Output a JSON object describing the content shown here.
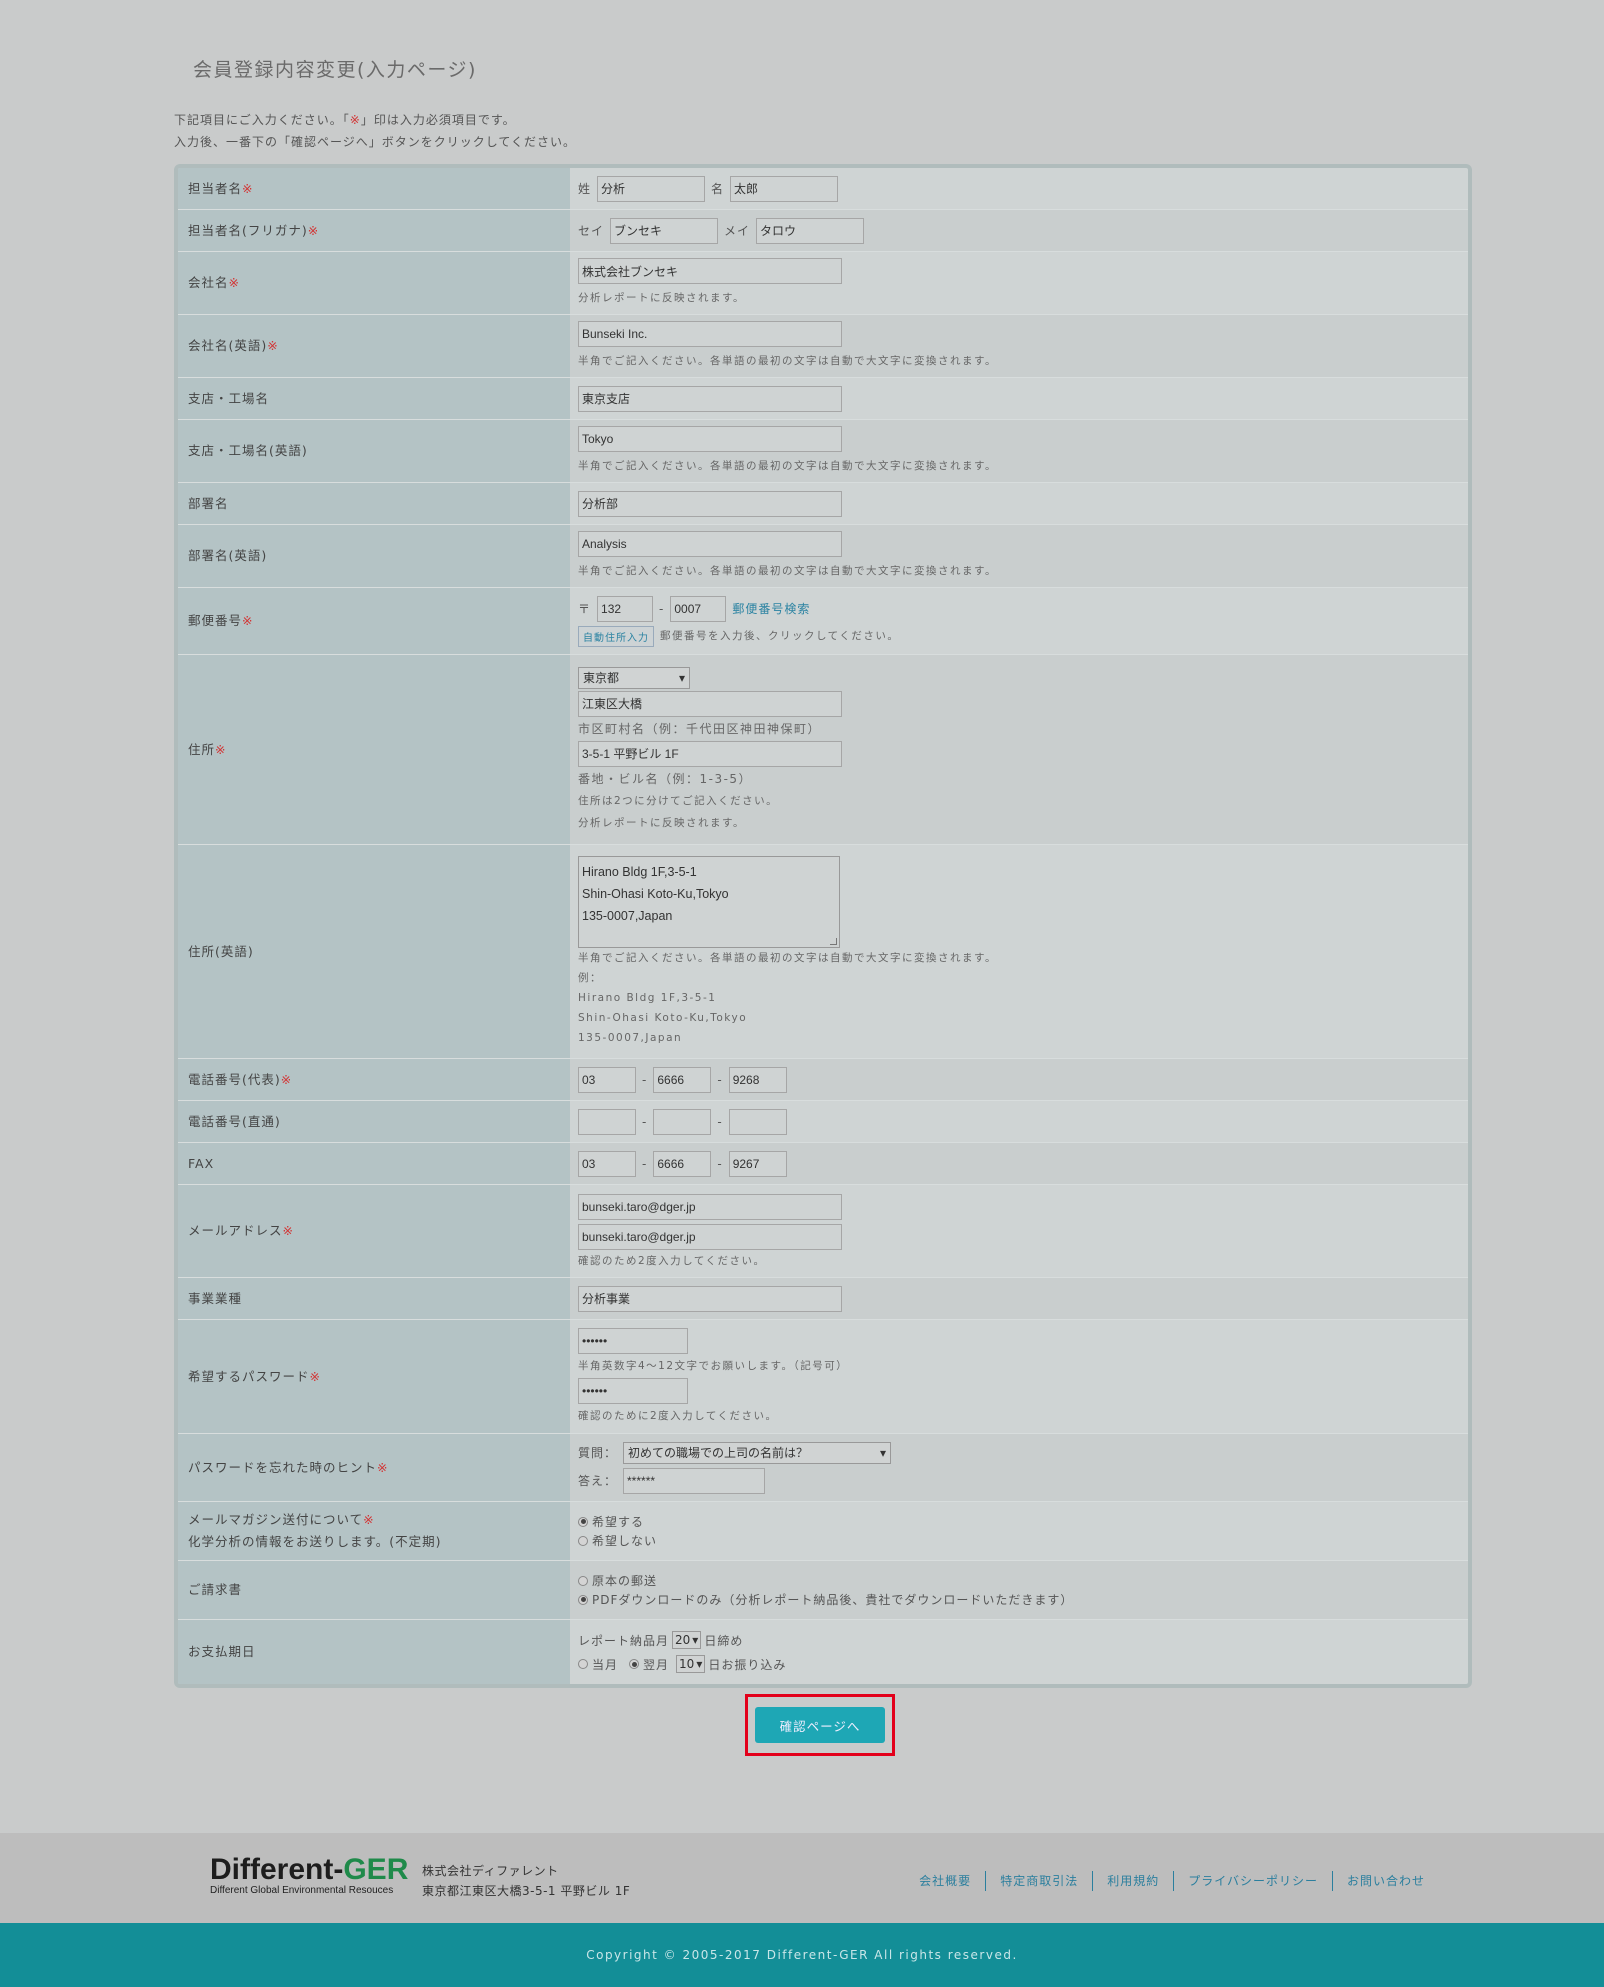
{
  "page_title": "会員登録内容変更(入力ページ)",
  "intro": {
    "line1_pre": "下記項目にご入力ください。「",
    "line1_mark": "※",
    "line1_post": "」印は入力必須項目です。",
    "line2": "入力後、一番下の「確認ページへ」ボタンをクリックしてください。"
  },
  "req": "※",
  "fields": {
    "name": {
      "label": "担当者名",
      "sei_label": "姓",
      "sei": "分析",
      "mei_label": "名",
      "mei": "太郎"
    },
    "kana": {
      "label": "担当者名(フリガナ)",
      "sei_label": "セイ",
      "sei": "ブンセキ",
      "mei_label": "メイ",
      "mei": "タロウ"
    },
    "company": {
      "label": "会社名",
      "value": "株式会社ブンセキ",
      "note": "分析レポートに反映されます。"
    },
    "company_en": {
      "label": "会社名(英語)",
      "value": "Bunseki Inc.",
      "note": "半角でご記入ください。各単語の最初の文字は自動で大文字に変換されます。"
    },
    "branch": {
      "label": "支店・工場名",
      "value": "東京支店"
    },
    "branch_en": {
      "label": "支店・工場名(英語)",
      "value": "Tokyo",
      "note": "半角でご記入ください。各単語の最初の文字は自動で大文字に変換されます。"
    },
    "dept": {
      "label": "部署名",
      "value": "分析部"
    },
    "dept_en": {
      "label": "部署名(英語)",
      "value": "Analysis",
      "note": "半角でご記入ください。各単語の最初の文字は自動で大文字に変換されます。"
    },
    "zip": {
      "label": "郵便番号",
      "mark": "〒",
      "z1": "132",
      "z2": "0007",
      "search": "郵便番号検索",
      "auto": "自動住所入力",
      "note": "郵便番号を入力後、クリックしてください。"
    },
    "address": {
      "label": "住所",
      "pref": "東京都",
      "city": "江東区大橋",
      "city_note": "市区町村名（例：千代田区神田神保町）",
      "street": "3-5-1 平野ビル 1F",
      "street_note": "番地・ビル名（例：1-3-5）",
      "note1": "住所は2つに分けてご記入ください。",
      "note2": "分析レポートに反映されます。"
    },
    "address_en": {
      "label": "住所(英語)",
      "l1": "Hirano Bldg 1F,3-5-1",
      "l2": "Shin-Ohasi Koto-Ku,Tokyo",
      "l3": "135-0007,Japan",
      "note": "半角でご記入ください。各単語の最初の文字は自動で大文字に変換されます。",
      "ex": "例：",
      "ex1": "Hirano Bldg 1F,3-5-1",
      "ex2": "Shin-Ohasi Koto-Ku,Tokyo",
      "ex3": "135-0007,Japan"
    },
    "tel": {
      "label": "電話番号(代表)",
      "t1": "03",
      "t2": "6666",
      "t3": "9268"
    },
    "tel_direct": {
      "label": "電話番号(直通)",
      "t1": "",
      "t2": "",
      "t3": ""
    },
    "fax": {
      "label": "FAX",
      "t1": "03",
      "t2": "6666",
      "t3": "9267"
    },
    "email": {
      "label": "メールアドレス",
      "v1": "bunseki.taro@dger.jp",
      "v2": "bunseki.taro@dger.jp",
      "note": "確認のため2度入力してください。"
    },
    "business": {
      "label": "事業業種",
      "value": "分析事業"
    },
    "password": {
      "label": "希望するパスワード",
      "v1": "••••••",
      "note1": "半角英数字4～12文字でお願いします。（記号可）",
      "v2": "••••••",
      "note2": "確認のために2度入力してください。"
    },
    "hint": {
      "label": "パスワードを忘れた時のヒント",
      "q_label": "質問：",
      "question": "初めての職場での上司の名前は？",
      "a_label": "答え：",
      "answer": "******"
    },
    "mailmag": {
      "label1": "メールマガジン送付について",
      "label2": "化学分析の情報をお送りします。(不定期)",
      "opt1": "希望する",
      "opt2": "希望しない"
    },
    "invoice": {
      "label": "ご請求書",
      "opt1": "原本の郵送",
      "opt2": "PDFダウンロードのみ（分析レポート納品後、貴社でダウンロードいただきます）"
    },
    "payment": {
      "label": "お支払期日",
      "pre": "レポート納品月",
      "close_day": "20",
      "close_suffix": "日締め",
      "opt1": "当月",
      "opt2": "翌月",
      "pay_day": "10",
      "pay_suffix": "日お振り込み"
    }
  },
  "submit_label": "確認ページへ",
  "footer": {
    "logo_a": "Different-",
    "logo_b": "GER",
    "logo_sub": "Different Global Environmental Resouces",
    "company_name": "株式会社ディファレント",
    "company_addr": "東京都江東区大橋3-5-1 平野ビル 1F",
    "links": [
      "会社概要",
      "特定商取引法",
      "利用規約",
      "プライバシーポリシー",
      "お問い合わせ"
    ],
    "copyright": "Copyright © 2005-2017 Different-GER All rights reserved."
  }
}
